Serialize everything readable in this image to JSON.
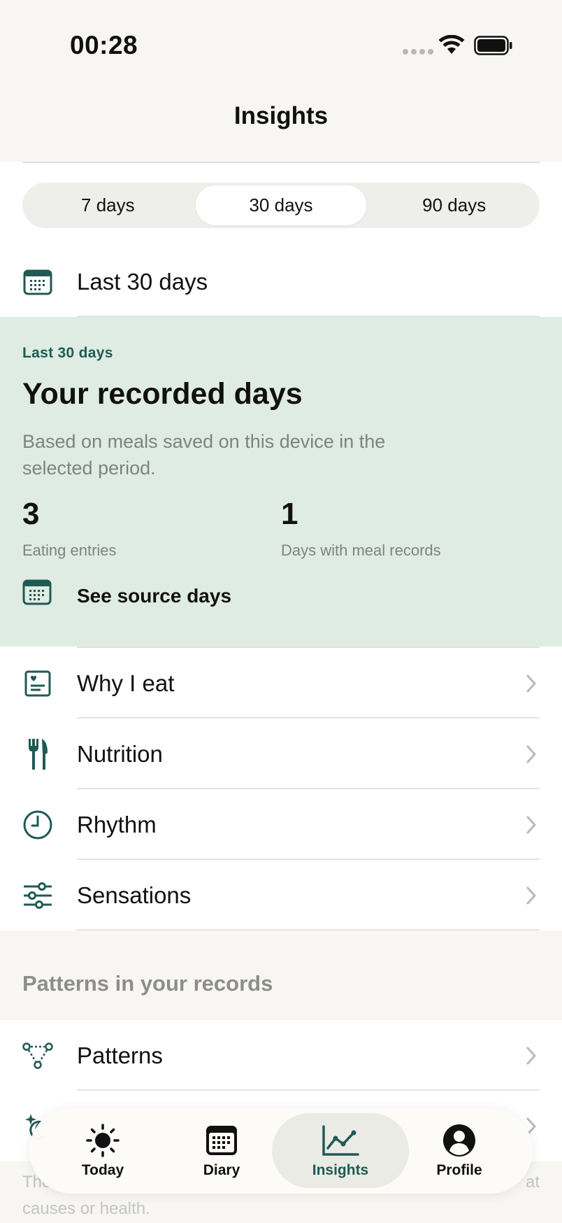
{
  "status_bar": {
    "time": "00:28"
  },
  "nav": {
    "title": "Insights"
  },
  "period_selector": {
    "options": [
      "7 days",
      "30 days",
      "90 days"
    ],
    "selected": "30 days"
  },
  "date_range": {
    "label": "Last 30 days"
  },
  "summary": {
    "kicker": "Last 30 days",
    "title": "Your recorded days",
    "subtitle": "Based on meals saved on this device in the selected period.",
    "stats": [
      {
        "value": "3",
        "caption": "Eating entries"
      },
      {
        "value": "1",
        "caption": "Days with meal records"
      }
    ],
    "source_link": "See source days"
  },
  "menu": [
    {
      "label": "Why I eat",
      "icon": "heart-journal-icon"
    },
    {
      "label": "Nutrition",
      "icon": "fork-knife-icon"
    },
    {
      "label": "Rhythm",
      "icon": "clock-icon"
    },
    {
      "label": "Sensations",
      "icon": "sliders-icon"
    }
  ],
  "patterns_section": {
    "header": "Patterns in your records",
    "items": [
      {
        "label": "Patterns",
        "icon": "pattern-nodes-icon"
      },
      {
        "label": "",
        "icon": "sparkle-moon-icon"
      }
    ]
  },
  "footer_note": {
    "line1": "The",
    "line2": "causes or health.",
    "line1_end": "at"
  },
  "tab_bar": {
    "tabs": [
      {
        "label": "Today",
        "icon": "sun-icon"
      },
      {
        "label": "Diary",
        "icon": "calendar-icon"
      },
      {
        "label": "Insights",
        "icon": "chart-icon"
      },
      {
        "label": "Profile",
        "icon": "person-icon"
      }
    ],
    "active": "Insights"
  },
  "colors": {
    "accent": "#1f5a54",
    "summary_bg": "#dfece3",
    "page_bg": "#f7f6f2"
  }
}
